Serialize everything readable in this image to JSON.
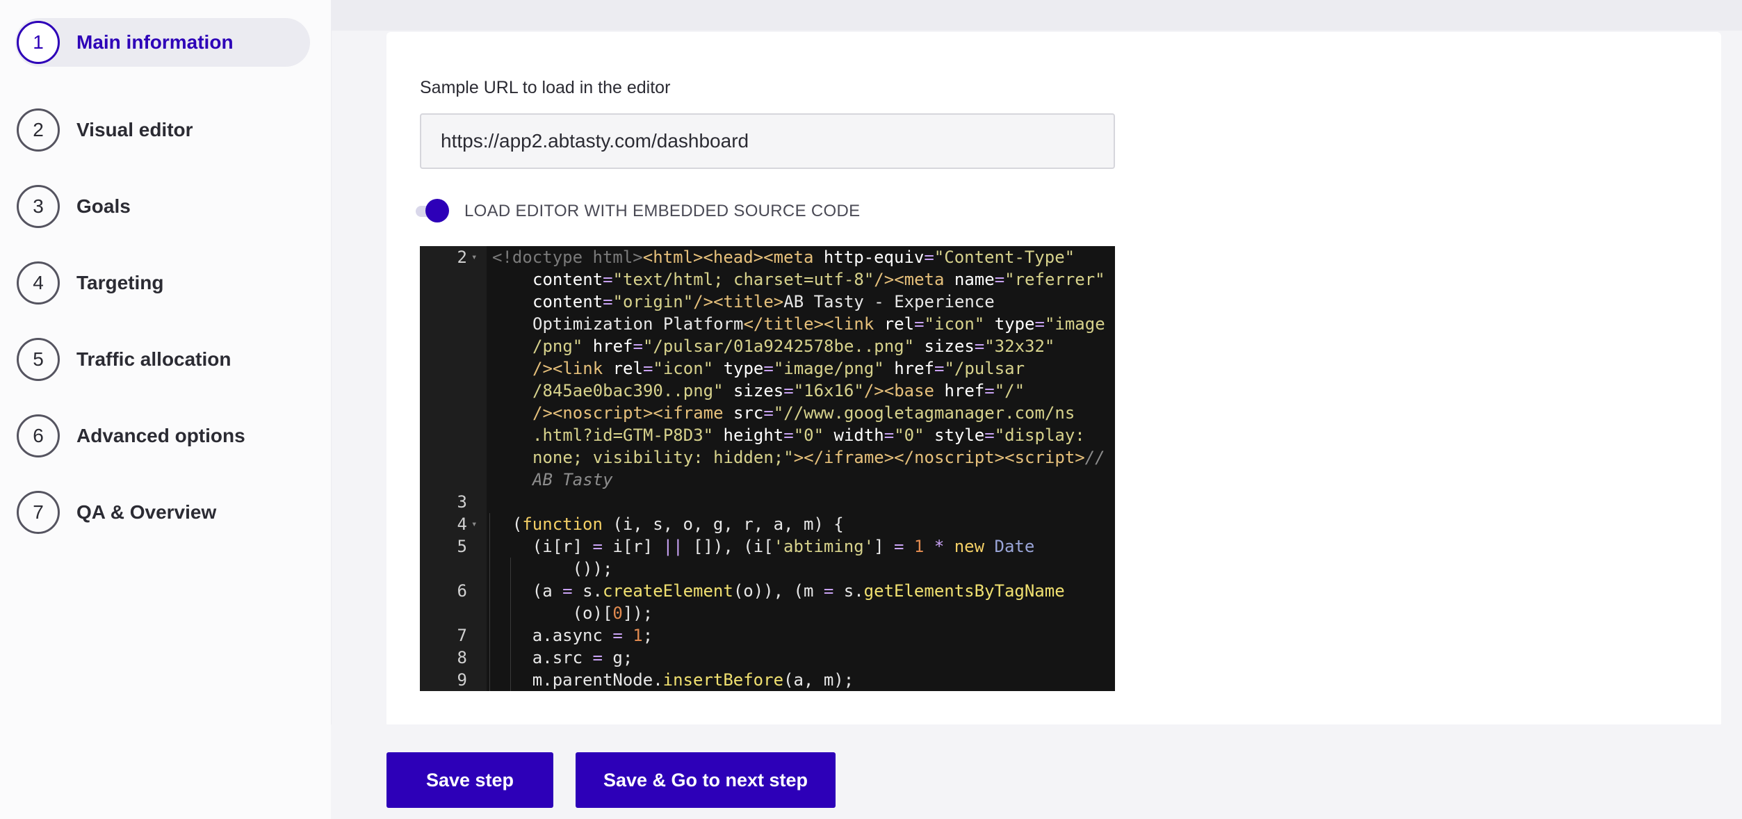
{
  "sidebar": {
    "steps": [
      {
        "number": "1",
        "label": "Main information"
      },
      {
        "number": "2",
        "label": "Visual editor"
      },
      {
        "number": "3",
        "label": "Goals"
      },
      {
        "number": "4",
        "label": "Targeting"
      },
      {
        "number": "5",
        "label": "Traffic allocation"
      },
      {
        "number": "6",
        "label": "Advanced options"
      },
      {
        "number": "7",
        "label": "QA & Overview"
      }
    ],
    "active_step": "1"
  },
  "main": {
    "url_label": "Sample URL to load in the editor",
    "url_value": "https://app2.abtasty.com/dashboard",
    "toggle_label": "LOAD EDITOR WITH EMBEDDED SOURCE CODE",
    "toggle_on": true
  },
  "code_editor": {
    "lines": [
      {
        "number": "2",
        "fold": true,
        "segments": [
          [
            "doc",
            "<!doctype html>"
          ],
          [
            "tag",
            "<html><head><meta "
          ],
          [
            "attr",
            "http-equiv"
          ],
          [
            "op",
            "="
          ],
          [
            "str",
            "\"Content-Type\""
          ]
        ]
      },
      {
        "number": "",
        "segments": [
          [
            "attr",
            "content"
          ],
          [
            "op",
            "="
          ],
          [
            "str",
            "\"text/html; charset=utf-8\""
          ],
          [
            "tag",
            "/><meta "
          ],
          [
            "attr",
            "name"
          ],
          [
            "op",
            "="
          ],
          [
            "str",
            "\"referrer\""
          ]
        ]
      },
      {
        "number": "",
        "segments": [
          [
            "attr",
            "content"
          ],
          [
            "op",
            "="
          ],
          [
            "str",
            "\"origin\""
          ],
          [
            "tag",
            "/><title>"
          ],
          [
            "pl",
            "AB Tasty - Experience"
          ]
        ]
      },
      {
        "number": "",
        "segments": [
          [
            "pl",
            "Optimization Platform"
          ],
          [
            "tag",
            "</title><link "
          ],
          [
            "attr",
            "rel"
          ],
          [
            "op",
            "="
          ],
          [
            "str",
            "\"icon\" "
          ],
          [
            "attr",
            "type"
          ],
          [
            "op",
            "="
          ],
          [
            "str",
            "\"image"
          ]
        ]
      },
      {
        "number": "",
        "segments": [
          [
            "str",
            "/png\" "
          ],
          [
            "attr",
            "href"
          ],
          [
            "op",
            "="
          ],
          [
            "str",
            "\"/pulsar/01a9242578be..png\" "
          ],
          [
            "attr",
            "sizes"
          ],
          [
            "op",
            "="
          ],
          [
            "str",
            "\"32x32\""
          ]
        ]
      },
      {
        "number": "",
        "segments": [
          [
            "tag",
            "/><link "
          ],
          [
            "attr",
            "rel"
          ],
          [
            "op",
            "="
          ],
          [
            "str",
            "\"icon\" "
          ],
          [
            "attr",
            "type"
          ],
          [
            "op",
            "="
          ],
          [
            "str",
            "\"image/png\" "
          ],
          [
            "attr",
            "href"
          ],
          [
            "op",
            "="
          ],
          [
            "str",
            "\"/pulsar"
          ]
        ]
      },
      {
        "number": "",
        "segments": [
          [
            "str",
            "/845ae0bac390..png\" "
          ],
          [
            "attr",
            "sizes"
          ],
          [
            "op",
            "="
          ],
          [
            "str",
            "\"16x16\""
          ],
          [
            "tag",
            "/><base "
          ],
          [
            "attr",
            "href"
          ],
          [
            "op",
            "="
          ],
          [
            "str",
            "\"/\""
          ]
        ]
      },
      {
        "number": "",
        "segments": [
          [
            "tag",
            "/><noscript><iframe "
          ],
          [
            "attr",
            "src"
          ],
          [
            "op",
            "="
          ],
          [
            "str",
            "\"//www.googletagmanager.com/ns"
          ]
        ]
      },
      {
        "number": "",
        "segments": [
          [
            "str",
            ".html?id=GTM-P8D3\" "
          ],
          [
            "attr",
            "height"
          ],
          [
            "op",
            "="
          ],
          [
            "str",
            "\"0\" "
          ],
          [
            "attr",
            "width"
          ],
          [
            "op",
            "="
          ],
          [
            "str",
            "\"0\" "
          ],
          [
            "attr",
            "style"
          ],
          [
            "op",
            "="
          ],
          [
            "str",
            "\"display:"
          ]
        ]
      },
      {
        "number": "",
        "segments": [
          [
            "str",
            "none; visibility: hidden;\""
          ],
          [
            "tag",
            "></iframe></noscript><script>"
          ],
          [
            "com",
            "//"
          ]
        ]
      },
      {
        "number": "",
        "segments": [
          [
            "com",
            "AB Tasty"
          ]
        ]
      },
      {
        "number": "3",
        "segments": [
          [
            "pl",
            ""
          ]
        ]
      },
      {
        "number": "4",
        "fold": true,
        "segments": [
          [
            "pl",
            "  ("
          ],
          [
            "kw",
            "function "
          ],
          [
            "pl",
            "(i, s, o, g, r, a, m) {"
          ]
        ]
      },
      {
        "number": "5",
        "segments": [
          [
            "pl",
            "    (i[r] "
          ],
          [
            "op",
            "= "
          ],
          [
            "pl",
            "i[r] "
          ],
          [
            "op",
            "|| "
          ],
          [
            "pl",
            "[]), (i["
          ],
          [
            "str",
            "'abtiming'"
          ],
          [
            "pl",
            "] "
          ],
          [
            "op",
            "= "
          ],
          [
            "num",
            "1 "
          ],
          [
            "op",
            "* "
          ],
          [
            "kw",
            "new "
          ],
          [
            "cls",
            "Date"
          ]
        ]
      },
      {
        "number": "",
        "segments": [
          [
            "pl",
            "        ());"
          ]
        ]
      },
      {
        "number": "6",
        "segments": [
          [
            "pl",
            "    (a "
          ],
          [
            "op",
            "= "
          ],
          [
            "pl",
            "s."
          ],
          [
            "fn",
            "createElement"
          ],
          [
            "pl",
            "(o)), (m "
          ],
          [
            "op",
            "= "
          ],
          [
            "pl",
            "s."
          ],
          [
            "fn",
            "getElementsByTagName"
          ]
        ]
      },
      {
        "number": "",
        "segments": [
          [
            "pl",
            "        (o)["
          ],
          [
            "num",
            "0"
          ],
          [
            "pl",
            "]);"
          ]
        ]
      },
      {
        "number": "7",
        "segments": [
          [
            "pl",
            "    a.async "
          ],
          [
            "op",
            "= "
          ],
          [
            "num",
            "1"
          ],
          [
            "pl",
            ";"
          ]
        ]
      },
      {
        "number": "8",
        "segments": [
          [
            "pl",
            "    a.src "
          ],
          [
            "op",
            "= "
          ],
          [
            "pl",
            "g;"
          ]
        ]
      },
      {
        "number": "9",
        "segments": [
          [
            "pl",
            "    m.parentNode."
          ],
          [
            "fn",
            "insertBefore"
          ],
          [
            "pl",
            "(a, m);"
          ]
        ]
      }
    ]
  },
  "footer": {
    "save_label": "Save step",
    "save_next_label": "Save & Go to next step"
  },
  "colors": {
    "accent": "#2d00b8",
    "sidebar_bg": "#fbfbfc",
    "editor_bg": "#141414"
  }
}
